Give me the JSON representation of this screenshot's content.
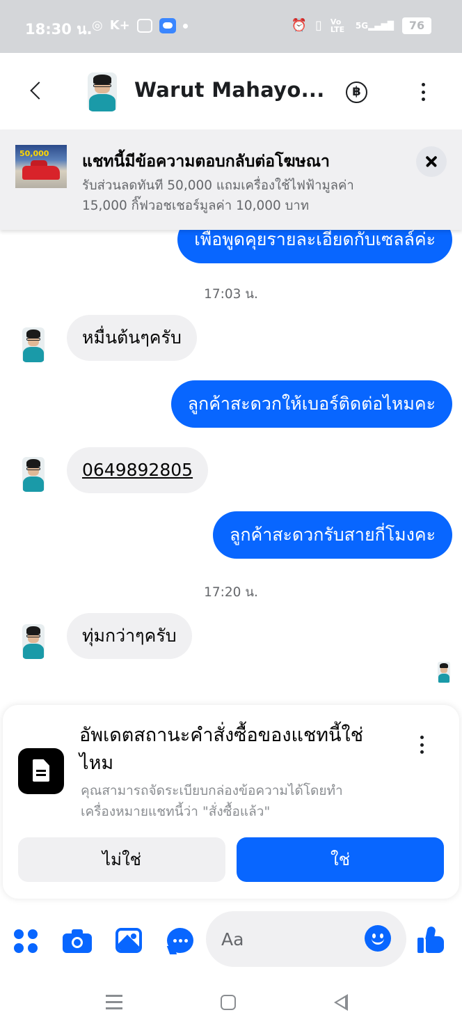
{
  "status_bar": {
    "time": "18:30 น.",
    "left_icons": [
      "hotspot-icon",
      "k-plus-icon",
      "youtube-icon",
      "weather-icon"
    ],
    "right_icons": [
      "alarm-icon",
      "vibrate-icon",
      "volte-icon",
      "signal-5g-icon"
    ],
    "volte_label": "Vo LTE",
    "network_label": "5G",
    "battery": "76"
  },
  "header": {
    "contact_name": "Warut Mahayo...",
    "currency_symbol": "฿"
  },
  "ad_banner": {
    "title": "แชทนี้มีข้อความตอบกลับต่อโฆษณา",
    "description": "รับส่วนลดทันที 50,000 แถมเครื่องใช้ไฟฟ้ามูลค่า 15,000 กิ๊ฟวอชเชอร์มูลค่า 10,000 บาท",
    "thumb_text": "50,000"
  },
  "messages": [
    {
      "type": "outgoing",
      "text": "เพื่อพูดคุยรายละเอียดกับเซลล์ค่ะ"
    },
    {
      "type": "timestamp",
      "text": "17:03 น."
    },
    {
      "type": "incoming",
      "text": "หมื่นต้นๆครับ"
    },
    {
      "type": "outgoing",
      "text": "ลูกค้าสะดวกให้เบอร์ติดต่อไหมคะ"
    },
    {
      "type": "incoming",
      "text": "0649892805"
    },
    {
      "type": "outgoing",
      "text": "ลูกค้าสะดวกรับสายกี่โมงคะ"
    },
    {
      "type": "timestamp",
      "text": "17:20 น."
    },
    {
      "type": "incoming",
      "text": "ทุ่มกว่าๆครับ"
    }
  ],
  "order_card": {
    "title": "อัพเดตสถานะคำสั่งซื้อของแชทนี้ใช่ไหม",
    "description": "คุณสามารถจัดระเบียบกล่องข้อความได้โดยทำเครื่องหมายแชทนี้ว่า \"สั่งซื้อแล้ว\"",
    "no_label": "ไม่ใช่",
    "yes_label": "ใช่"
  },
  "composer": {
    "placeholder": "Aa"
  },
  "colors": {
    "messenger_blue": "#0866ff",
    "bubble_gray": "#f0f0f2",
    "status_bar": "#d4d6d9"
  }
}
